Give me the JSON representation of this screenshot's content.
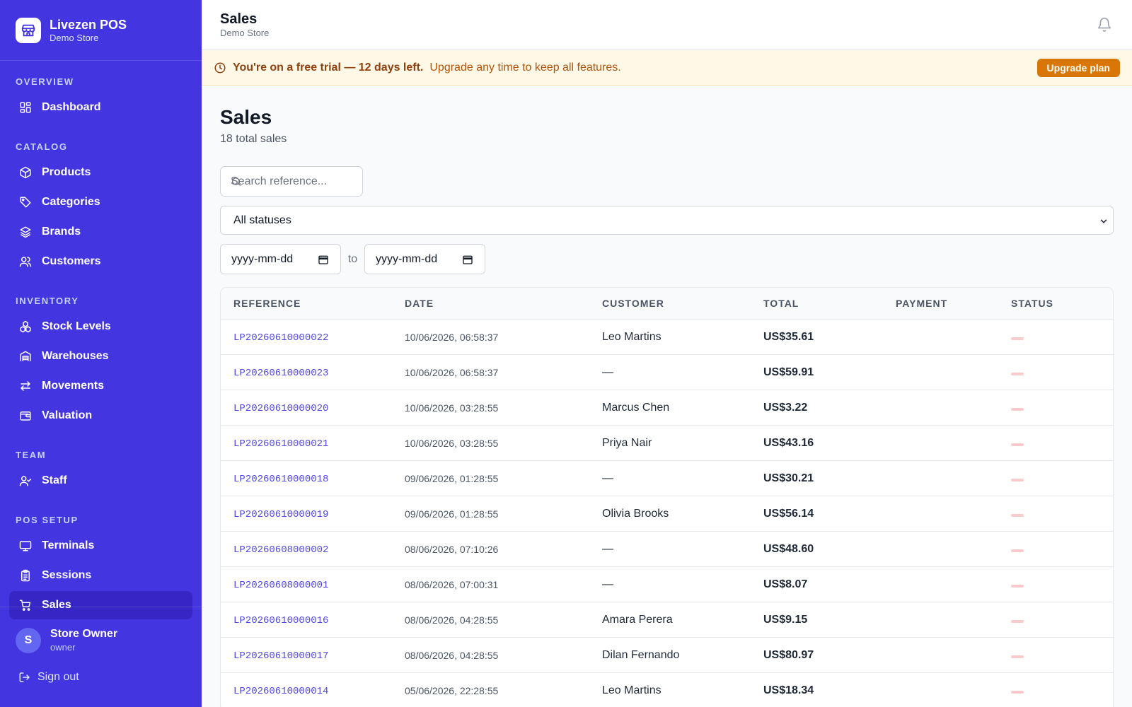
{
  "brand": {
    "name": "Livezen POS",
    "store": "Demo Store"
  },
  "nav": {
    "sections": [
      {
        "title": "OVERVIEW",
        "items": [
          {
            "label": "Dashboard",
            "icon": "dashboard-icon"
          }
        ]
      },
      {
        "title": "CATALOG",
        "items": [
          {
            "label": "Products",
            "icon": "box-icon"
          },
          {
            "label": "Categories",
            "icon": "tag-icon"
          },
          {
            "label": "Brands",
            "icon": "layers-icon"
          },
          {
            "label": "Customers",
            "icon": "users-icon"
          }
        ]
      },
      {
        "title": "INVENTORY",
        "items": [
          {
            "label": "Stock Levels",
            "icon": "boxes-icon"
          },
          {
            "label": "Warehouses",
            "icon": "warehouse-icon"
          },
          {
            "label": "Movements",
            "icon": "arrows-icon"
          },
          {
            "label": "Valuation",
            "icon": "wallet-icon"
          }
        ]
      },
      {
        "title": "TEAM",
        "items": [
          {
            "label": "Staff",
            "icon": "user-check-icon"
          }
        ]
      },
      {
        "title": "POS SETUP",
        "items": [
          {
            "label": "Terminals",
            "icon": "monitor-icon"
          },
          {
            "label": "Sessions",
            "icon": "clipboard-icon"
          },
          {
            "label": "Sales",
            "icon": "cart-icon",
            "active": true
          }
        ]
      }
    ]
  },
  "user": {
    "initial": "S",
    "name": "Store Owner",
    "role": "owner",
    "signout": "Sign out"
  },
  "topbar": {
    "title": "Sales",
    "subtitle": "Demo Store"
  },
  "banner": {
    "strong": "You're on a free trial — 12 days left.",
    "text": "Upgrade any time to keep all features.",
    "button": "Upgrade plan"
  },
  "page": {
    "title": "Sales",
    "subtitle": "18 total sales"
  },
  "filters": {
    "search_placeholder": "Search reference...",
    "status_selected": "All statuses",
    "date_from": "yyyy-mm-dd",
    "date_to_label": "to",
    "date_to": "yyyy-mm-dd"
  },
  "table": {
    "headers": [
      "REFERENCE",
      "DATE",
      "CUSTOMER",
      "TOTAL",
      "PAYMENT",
      "STATUS"
    ],
    "rows": [
      {
        "ref": "LP20260610000022",
        "date": "10/06/2026, 06:58:37",
        "customer": "Leo Martins",
        "total": "US$35.61"
      },
      {
        "ref": "LP20260610000023",
        "date": "10/06/2026, 06:58:37",
        "customer": "—",
        "total": "US$59.91"
      },
      {
        "ref": "LP20260610000020",
        "date": "10/06/2026, 03:28:55",
        "customer": "Marcus Chen",
        "total": "US$3.22"
      },
      {
        "ref": "LP20260610000021",
        "date": "10/06/2026, 03:28:55",
        "customer": "Priya Nair",
        "total": "US$43.16"
      },
      {
        "ref": "LP20260610000018",
        "date": "09/06/2026, 01:28:55",
        "customer": "—",
        "total": "US$30.21"
      },
      {
        "ref": "LP20260610000019",
        "date": "09/06/2026, 01:28:55",
        "customer": "Olivia Brooks",
        "total": "US$56.14"
      },
      {
        "ref": "LP20260608000002",
        "date": "08/06/2026, 07:10:26",
        "customer": "—",
        "total": "US$48.60"
      },
      {
        "ref": "LP20260608000001",
        "date": "08/06/2026, 07:00:31",
        "customer": "—",
        "total": "US$8.07"
      },
      {
        "ref": "LP20260610000016",
        "date": "08/06/2026, 04:28:55",
        "customer": "Amara Perera",
        "total": "US$9.15"
      },
      {
        "ref": "LP20260610000017",
        "date": "08/06/2026, 04:28:55",
        "customer": "Dilan Fernando",
        "total": "US$80.97"
      },
      {
        "ref": "LP20260610000014",
        "date": "05/06/2026, 22:28:55",
        "customer": "Leo Martins",
        "total": "US$18.34"
      }
    ]
  },
  "colors": {
    "sidebar": "#4335e0",
    "active": "#3627c4",
    "accent": "#4f46e5",
    "upgrade": "#d97706"
  }
}
